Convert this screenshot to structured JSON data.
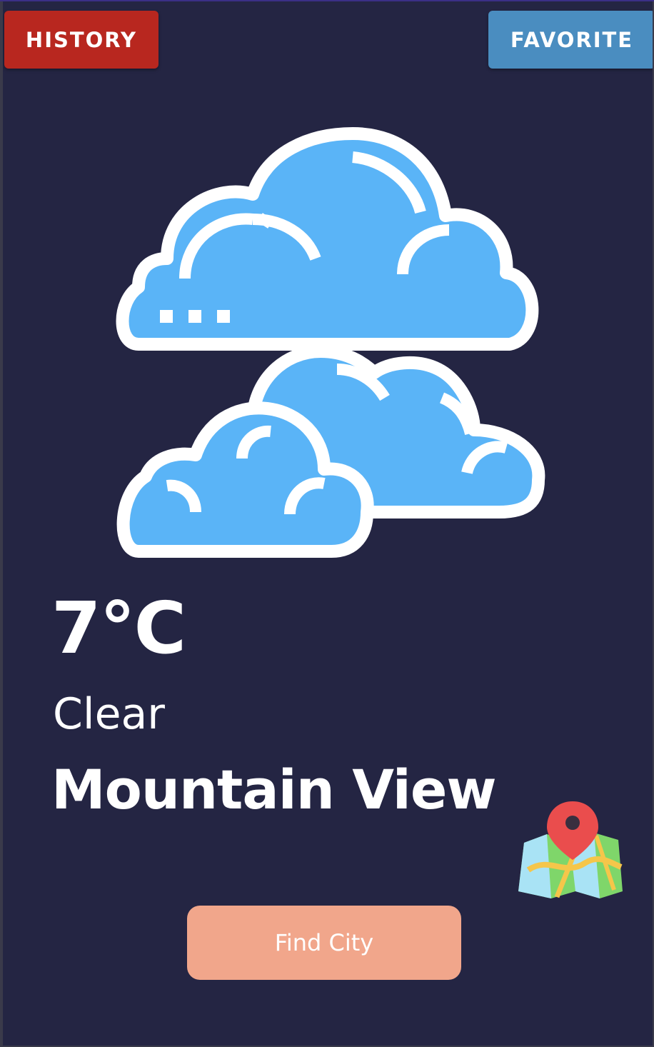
{
  "header": {
    "history_label": "HISTORY",
    "favorite_label": "FAVORITE"
  },
  "weather": {
    "icon": "cloudy-icon",
    "temperature": "7°C",
    "condition": "Clear",
    "city": "Mountain View"
  },
  "actions": {
    "map_icon": "map-pin-icon",
    "find_city_label": "Find City"
  },
  "colors": {
    "background": "#242543",
    "history_button": "#b8271f",
    "favorite_button": "#4a8dc0",
    "find_city_button": "#f1a68b",
    "cloud_fill": "#5ab4f7"
  }
}
